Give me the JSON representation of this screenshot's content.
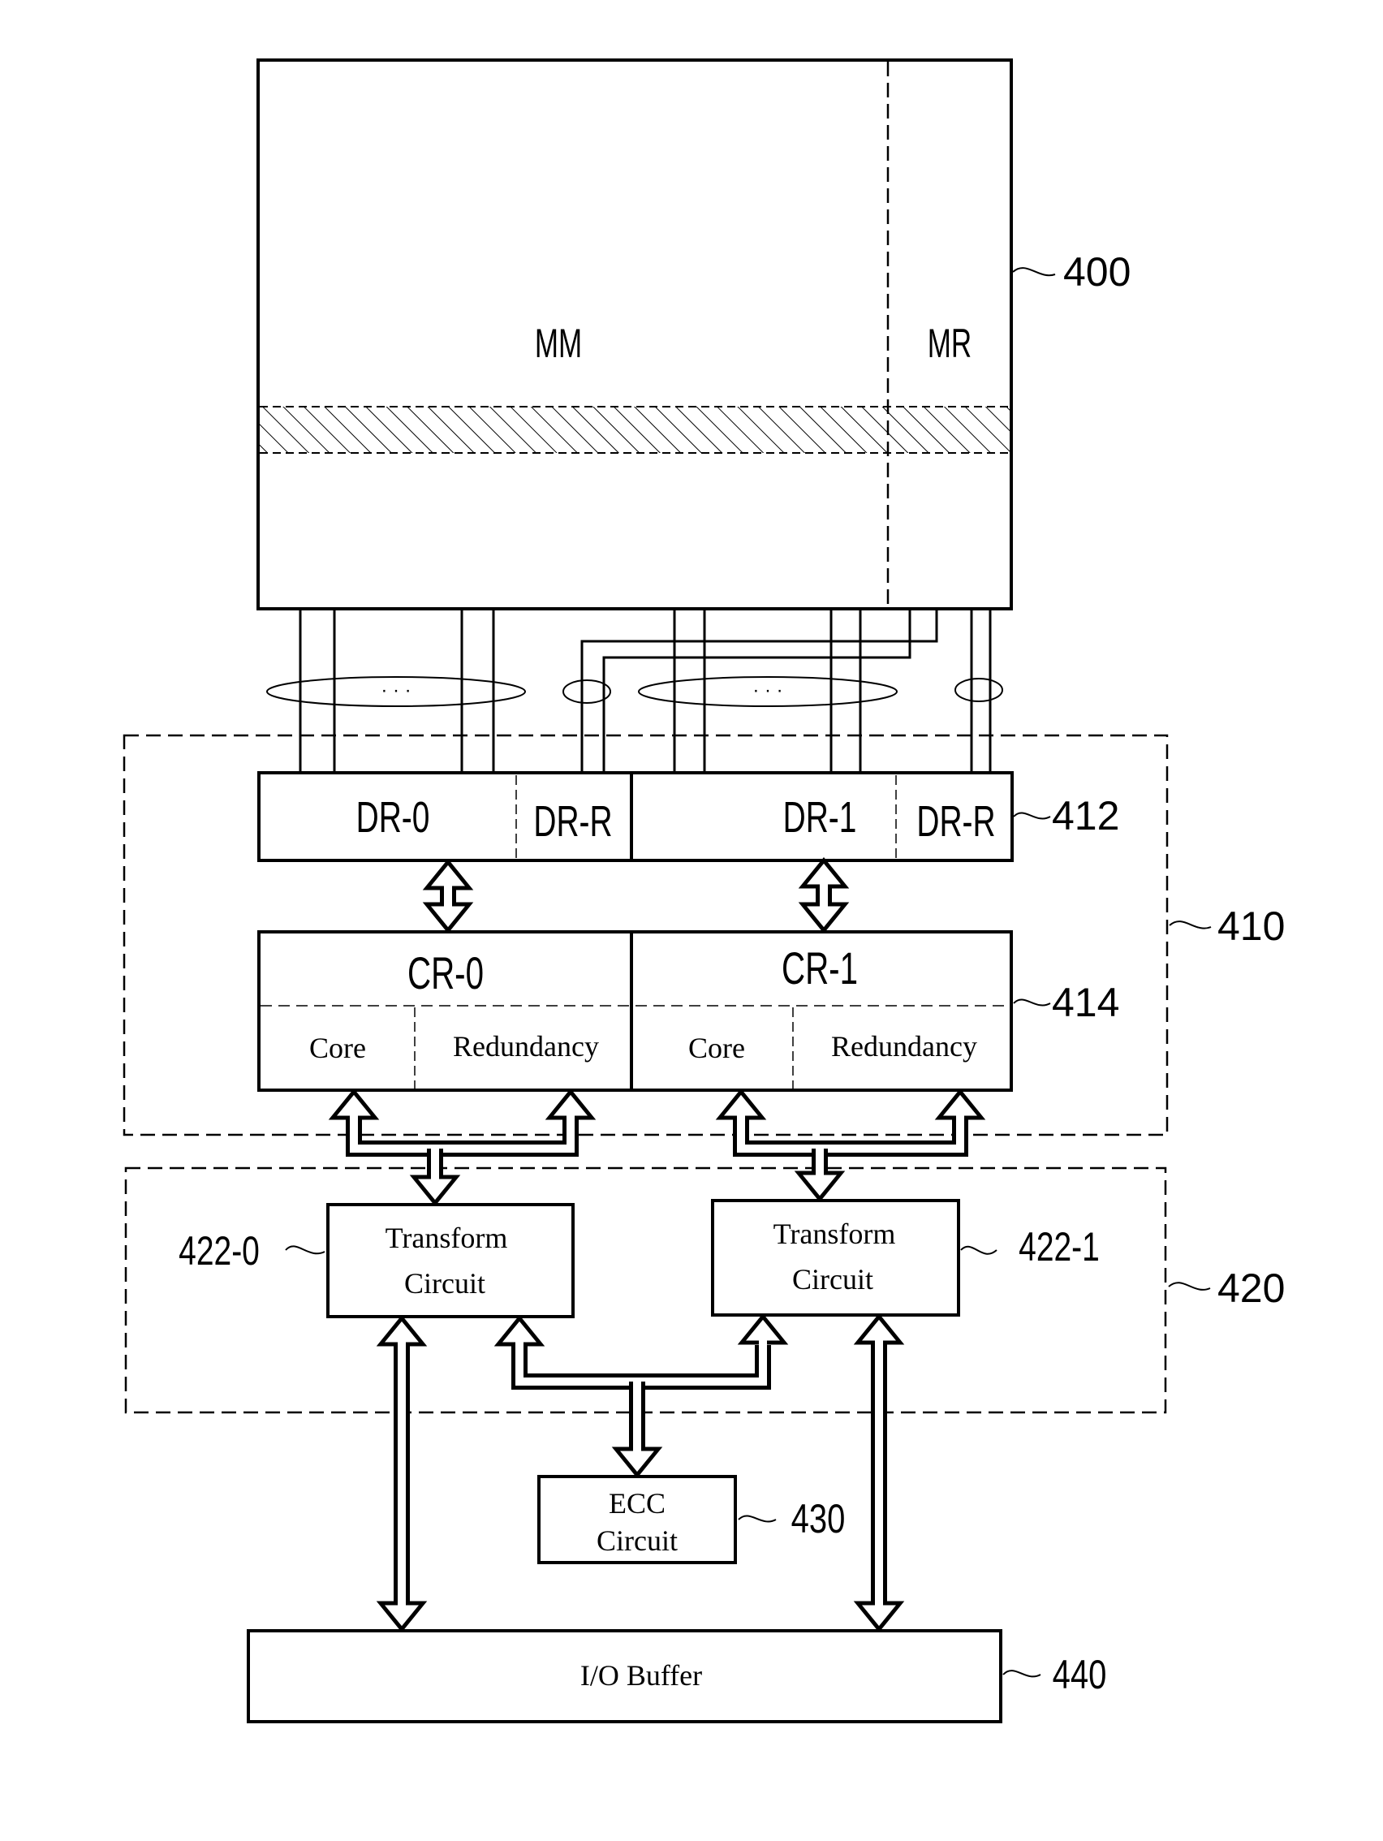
{
  "diagram": {
    "memory_array": {
      "ref": "400",
      "main_label": "MM",
      "redundancy_label": "MR"
    },
    "bitline_groups": {
      "ellipsis": "· · ·"
    },
    "block_410": {
      "ref": "410"
    },
    "data_registers": {
      "ref": "412",
      "dr0": "DR-0",
      "dr0_r": "DR-R",
      "dr1": "DR-1",
      "dr1_r": "DR-R"
    },
    "cache_registers": {
      "ref": "414",
      "cr0": "CR-0",
      "cr1": "CR-1",
      "core": "Core",
      "redundancy": "Redundancy"
    },
    "block_420": {
      "ref": "420"
    },
    "transform_0": {
      "ref": "422-0",
      "line1": "Transform",
      "line2": "Circuit"
    },
    "transform_1": {
      "ref": "422-1",
      "line1": "Transform",
      "line2": "Circuit"
    },
    "ecc": {
      "ref": "430",
      "line1": "ECC",
      "line2": "Circuit"
    },
    "io_buffer": {
      "ref": "440",
      "label": "I/O Buffer"
    }
  }
}
